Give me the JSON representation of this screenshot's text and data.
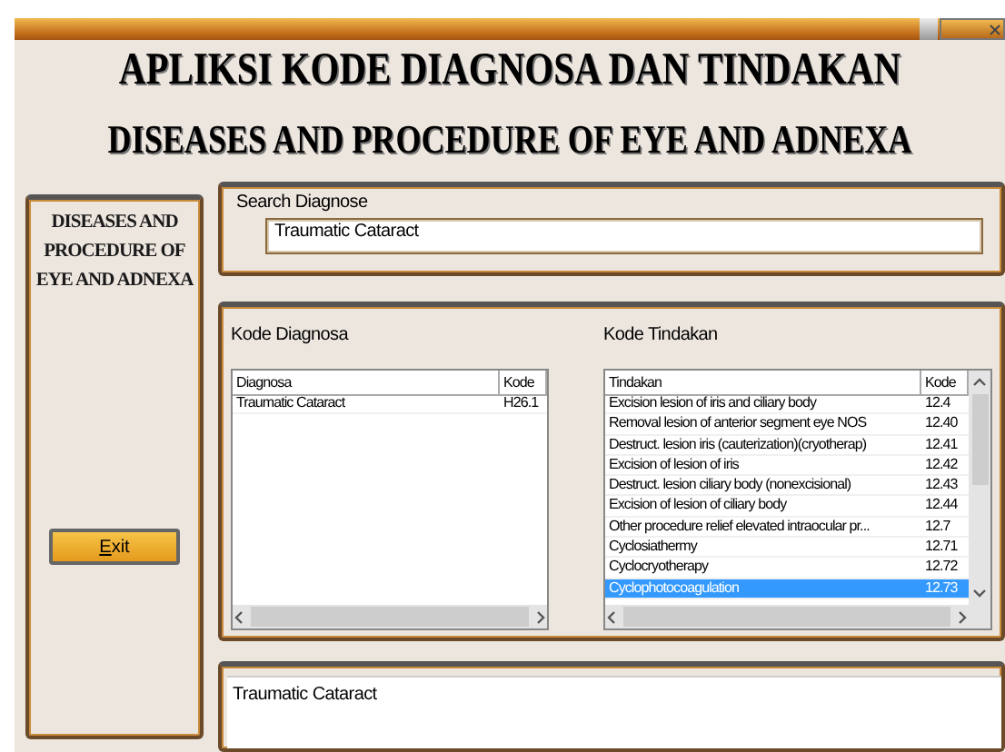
{
  "heading": "APLIKSI KODE DIAGNOSA DAN TINDAKAN",
  "subheading": "DISEASES AND PROCEDURE OF EYE AND ADNEXA",
  "side_panel": {
    "title": "DISEASES AND PROCEDURE OF EYE AND ADNEXA",
    "exit_button": "Exit"
  },
  "search": {
    "label": "Search Diagnose",
    "value": "Traumatic Cataract"
  },
  "codes": {
    "diagnosa_label": "Kode Diagnosa",
    "diagnosa_table": {
      "columns": [
        "Diagnosa",
        "Kode"
      ],
      "rows": [
        {
          "cells": [
            "Traumatic Cataract",
            "H26.1"
          ],
          "selected": false
        }
      ]
    },
    "tindakan_label": "Kode Tindakan",
    "tindakan_table": {
      "columns": [
        "Tindakan",
        "Kode"
      ],
      "rows": [
        {
          "cells": [
            "Excision lesion of iris and ciliary body",
            "12.4"
          ],
          "selected": false
        },
        {
          "cells": [
            "Removal lesion of anterior segment eye NOS",
            "12.40"
          ],
          "selected": false
        },
        {
          "cells": [
            "Destruct. lesion iris (cauterization)(cryotherap)",
            "12.41"
          ],
          "selected": false
        },
        {
          "cells": [
            "Excision of lesion of iris",
            "12.42"
          ],
          "selected": false
        },
        {
          "cells": [
            "Destruct. lesion ciliary body (nonexcisional)",
            "12.43"
          ],
          "selected": false
        },
        {
          "cells": [
            "Excision of lesion of ciliary body",
            "12.44"
          ],
          "selected": false
        },
        {
          "cells": [
            "Other procedure relief elevated intraocular pr...",
            "12.7"
          ],
          "selected": false
        },
        {
          "cells": [
            "Cyclosiathermy",
            "12.71"
          ],
          "selected": false
        },
        {
          "cells": [
            "Cyclocryotherapy",
            "12.72"
          ],
          "selected": false
        },
        {
          "cells": [
            "Cyclophotocoagulation",
            "12.73"
          ],
          "selected": true
        }
      ]
    }
  },
  "result": {
    "value": "Traumatic Cataract"
  }
}
